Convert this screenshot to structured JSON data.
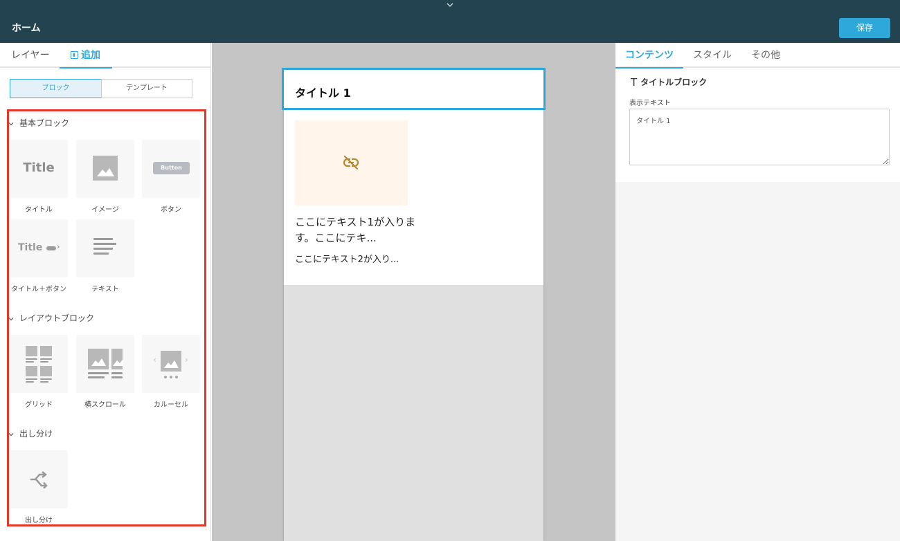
{
  "header": {
    "collapse_icon": "chevron-down-icon",
    "title": "ホーム",
    "save_label": "保存"
  },
  "left_panel": {
    "tabs": [
      {
        "label": "レイヤー",
        "active": false
      },
      {
        "label": "追加",
        "active": true,
        "icon": "plus-square-icon"
      }
    ],
    "segments": [
      {
        "label": "ブロック",
        "active": true
      },
      {
        "label": "テンプレート",
        "active": false
      }
    ],
    "sections": [
      {
        "title": "基本ブロック",
        "items": [
          {
            "label": "タイトル",
            "icon": "title-icon",
            "icon_text": "Title"
          },
          {
            "label": "イメージ",
            "icon": "image-icon"
          },
          {
            "label": "ボタン",
            "icon": "button-icon",
            "icon_text": "Button"
          },
          {
            "label": "タイトル＋ボタン",
            "icon": "title-button-icon",
            "icon_text": "Title"
          },
          {
            "label": "テキスト",
            "icon": "text-lines-icon"
          }
        ]
      },
      {
        "title": "レイアウトブロック",
        "items": [
          {
            "label": "グリッド",
            "icon": "grid-icon"
          },
          {
            "label": "横スクロール",
            "icon": "horizontal-scroll-icon"
          },
          {
            "label": "カルーセル",
            "icon": "carousel-icon"
          }
        ]
      },
      {
        "title": "出し分け",
        "items": [
          {
            "label": "出し分け",
            "icon": "shuffle-icon"
          }
        ]
      }
    ],
    "highlight_color": "#e53727"
  },
  "canvas": {
    "title_block": "タイトル 1",
    "card": {
      "image_icon": "broken-link-icon",
      "text1": "ここにテキスト1が入ります。ここにテキ...",
      "text2": "ここにテキスト2が入り..."
    }
  },
  "right_panel": {
    "tabs": [
      {
        "label": "コンテンツ",
        "active": true
      },
      {
        "label": "スタイル",
        "active": false
      },
      {
        "label": "その他",
        "active": false
      }
    ],
    "block_title": "タイトルブロック",
    "block_icon": "text-t-icon",
    "field_label": "表示テキスト",
    "field_value": "タイトル 1"
  },
  "colors": {
    "header_bg": "#22434f",
    "accent": "#2ea7db",
    "canvas_bg": "#c5c5c5",
    "placeholder_bg": "#fff5eb",
    "placeholder_icon": "#b08a2c"
  }
}
